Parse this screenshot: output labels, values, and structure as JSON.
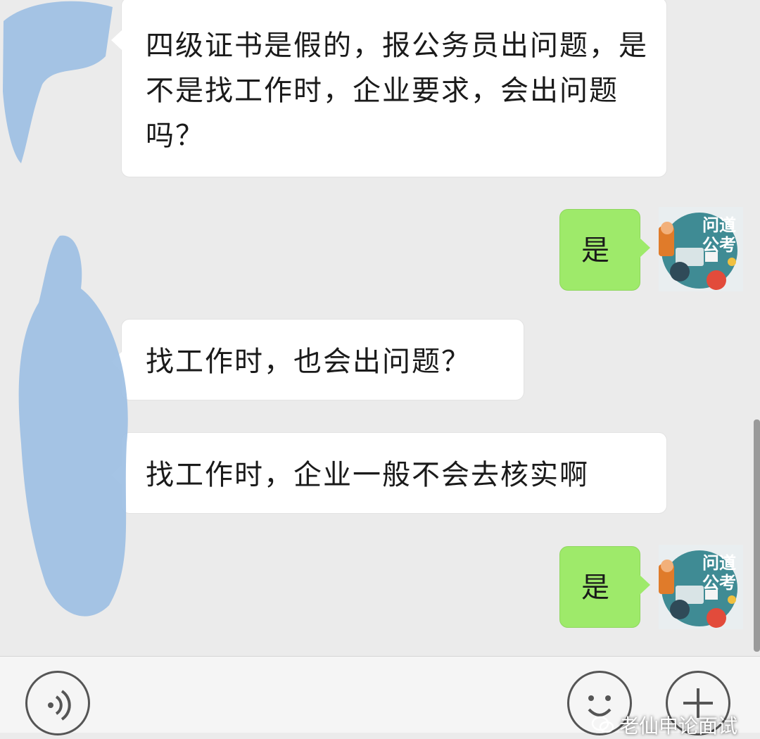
{
  "messages": [
    {
      "direction": "in",
      "text": "四级证书是假的，报公务员出问题，是不是找工作时，企业要求，会出问题吗？"
    },
    {
      "direction": "out",
      "text": "是"
    },
    {
      "direction": "in",
      "text": "找工作时，也会出问题？"
    },
    {
      "direction": "in",
      "text": "找工作时，企业一般不会去核实啊"
    },
    {
      "direction": "out",
      "text": "是"
    }
  ],
  "avatar_out": {
    "line1": "问道",
    "line2": "公考"
  },
  "watermark": {
    "text": "老仙申论面试"
  },
  "colors": {
    "chat_bg": "#ebebeb",
    "incoming_bubble": "#ffffff",
    "outgoing_bubble": "#9eea6a",
    "scribble": "#9dbfe3",
    "avatar_teal": "#3f8b94"
  },
  "icons": {
    "voice": "voice-icon",
    "emoji": "emoji-icon",
    "more": "plus-icon",
    "wechat": "wechat-logo-icon"
  }
}
